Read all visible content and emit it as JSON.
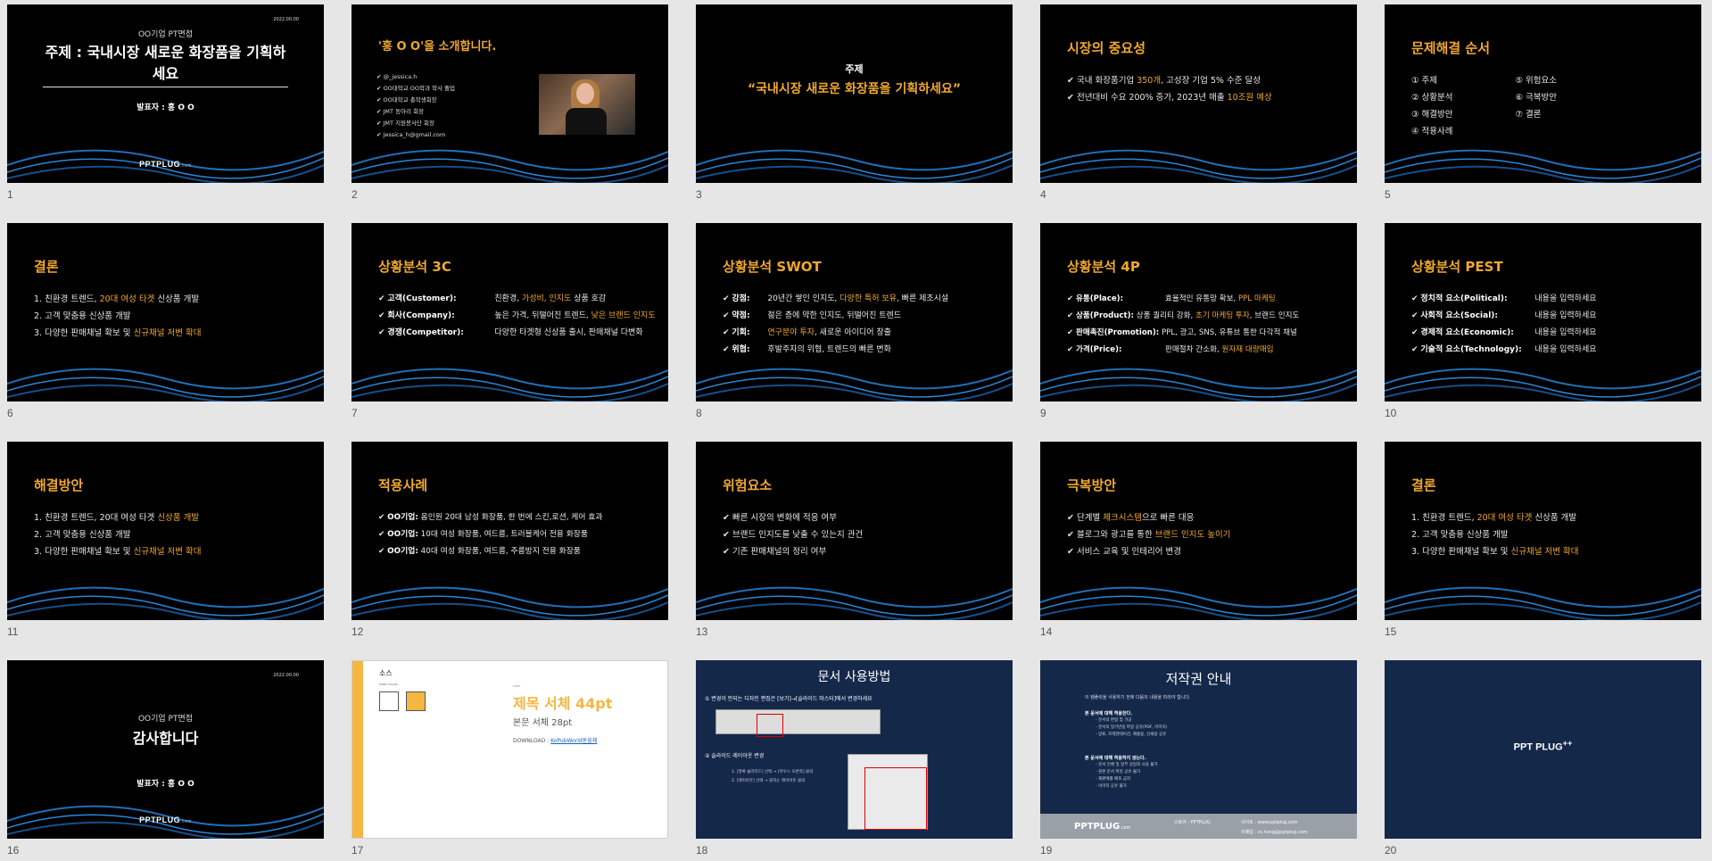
{
  "slides": [
    {
      "n": "1",
      "date": "2022.00.00",
      "sub": "OO기업 PT면접",
      "title": "주제 : 국내시장 새로운 화장품을 기획하세요",
      "presenter": "발표자 : 홍 O O",
      "logo": "PPTPLUG",
      "logo_suffix": ".com"
    },
    {
      "n": "2",
      "title": "'홍 O O'을 소개합니다.",
      "items": [
        "@_jessica.h",
        "OO대학교 OO학과 학사 졸업",
        "OO대학교 총학생회장",
        "JMT 동아리 회장",
        "JMT 지원봉사단 회장",
        "jessica_h@gmail.com"
      ]
    },
    {
      "n": "3",
      "title": "주제",
      "subtitle": "“국내시장 새로운 화장품을 기획하세요”"
    },
    {
      "n": "4",
      "title": "시장의 중요성",
      "l1a": "국내 화장품기업 ",
      "l1b": "350개",
      "l1c": ", 고성장 기업 5% 수준 달성",
      "l2a": "전년대비 수요 200% 증가, 2023년 매출 ",
      "l2b": "10조원 예상"
    },
    {
      "n": "5",
      "title": "문제해결 순서",
      "col1": [
        "① 주제",
        "② 상황분석",
        "③ 해결방안",
        "④ 적용사례"
      ],
      "col2": [
        "⑤ 위험요소",
        "⑥ 극복방안",
        "⑦ 결론"
      ]
    },
    {
      "n": "6",
      "title": "결론",
      "l1a": "1.  친환경 트렌드, ",
      "l1b": "20대 여성 타겟",
      "l1c": " 신상품 개발",
      "l2": "2.  고객 맞춤용 신상품 개발",
      "l3a": "3.  다양한 판매채널 확보 및 ",
      "l3b": "신규채널 저변 확대"
    },
    {
      "n": "7",
      "title": "상황분석 3C",
      "r1k": "고객(Customer):",
      "r1a": "친환경, ",
      "r1b": "가성비, 인지도",
      "r1c": " 상품 호감",
      "r2k": "회사(Company):",
      "r2a": "높은 가격, 뒤떨어진 트렌드, ",
      "r2b": "낮은 브랜드 인지도",
      "r3k": "경쟁(Competitor):",
      "r3a": "다양한 타겟형 신상품 출시, 판매채널 다변화"
    },
    {
      "n": "8",
      "title": "상황분석 SWOT",
      "r1k": "강점:",
      "r1a": "20년간 쌓인 인지도, ",
      "r1b": "다양한 특허 보유",
      "r1c": ", 빠른 제조시설",
      "r2k": "약점:",
      "r2a": "젊은 층에 약한 인지도, 뒤떨어진 트렌드",
      "r3k": "기회:",
      "r3a": "연구분야 투자",
      "r3b": ", 새로운 아이디어 창출",
      "r4k": "위협:",
      "r4a": "후발주자의 위협, 트렌드의 빠른 변화"
    },
    {
      "n": "9",
      "title": "상황분석 4P",
      "r1k": "유통(Place):",
      "r1a": "효율적인 유통망 확보, ",
      "r1b": "PPL 마케팅",
      "r2k": "상품(Product):",
      "r2a": "상품 퀄리티 강화, ",
      "r2b": "초기 마케팅 투자",
      "r2c": ", 브랜드 인지도",
      "r3k": "판매촉진(Promotion):",
      "r3a": "PPL, 광고, SNS, 유튜브 통한 다각적 채널",
      "r4k": "가격(Price):",
      "r4a": "판매절차 간소화, ",
      "r4b": "원자재 대량매입"
    },
    {
      "n": "10",
      "title": "상황분석 PEST",
      "r1k": "정치적 요소(Political):",
      "r2k": "사회적 요소(Social):",
      "r3k": "경제적 요소(Economic):",
      "r4k": "기술적 요소(Technology):",
      "val": "내용을 입력하세요"
    },
    {
      "n": "11",
      "title": "해결방안",
      "l1a": "1.  친환경 트렌드, 20대 여성 타겟 ",
      "l1b": "신상품 개발",
      "l2": "2.  고객 맞춤용 신상품 개발",
      "l3a": "3.  다양한 판매채널 확보 및 ",
      "l3b": "신규채널 저변 확대"
    },
    {
      "n": "12",
      "title": "적용사례",
      "r1k": "OO기업:",
      "r1a": "옴인원 20대 남성 화장품, 한 번에 스킨,로션, 케어 효과",
      "r2k": "OO기업:",
      "r2a": "10대 여성 화장품, 여드름, 트러블케어 전용 화장품",
      "r3k": "OO기업:",
      "r3a": "40대 여성 화장품, 여드름, 주름방지 전용 화장품"
    },
    {
      "n": "13",
      "title": "위험요소",
      "items": [
        "빠른 시장의 변화에 적응 여부",
        "브랜드 인지도를 낮출 수 있는지 관건",
        "기존 판매채널의 정리 여부"
      ]
    },
    {
      "n": "14",
      "title": "극복방안",
      "l1a": "단계별 ",
      "l1b": "체크시스템",
      "l1c": "으로 빠른 대응",
      "l2a": "블로그와 광고를 통한 ",
      "l2b": "브랜드 인지도 높이기",
      "l3": "서비스 교육 및 인테리어 변경"
    },
    {
      "n": "15",
      "title": "결론",
      "l1a": "1.  친환경 트렌드, ",
      "l1b": "20대 여성 타겟",
      "l1c": " 신상품 개발",
      "l2": "2.  고객 맞춤용 신상품 개발",
      "l3a": "3.  다양한 판매채널 확보 및 ",
      "l3b": "신규채널 저변 확대"
    },
    {
      "n": "16",
      "date": "2022.00.00",
      "sub": "OO기업 PT면접",
      "title": "감사합니다",
      "presenter": "발표자 : 홍 O O",
      "logo": "PPTPLUG",
      "logo_suffix": ".com"
    },
    {
      "n": "17",
      "label": "소스",
      "label2": "POINT COLOR",
      "fonttag": "FONT",
      "t1": "제목 서체 44pt",
      "t2": "본문 서체 28pt",
      "t3": "DOWNLOAD :",
      "t3link": "KoPubWorld돋움체"
    },
    {
      "n": "18",
      "title": "문서 사용방법",
      "step1": "①  변경이 안되는 디자인 편집은 [보기]→[슬라이드 마스터]에서 변경하세요",
      "step2": "②  슬라이드 레이아웃 변경",
      "sub1": "1. [영록 슬라이드] 선택 → [마우스 오른쪽] 클릭",
      "sub2": "2. [레이아웃] 선택 → 원하는 레이아웃 클릭"
    },
    {
      "n": "19",
      "title": "저작권 안내",
      "p": "이 템플릿을 사용하기 전에 다음의 내용을 따라야 합니다.",
      "h1": "본 문서에 대해 허용한다.",
      "a": [
        "문서의 변형 및 가공",
        "문서의 일기반용 파일 공유(PDF, 이미지)",
        "방표, 프레젠테이션, 제출용, 인쇄용 공유"
      ],
      "h2": "본 문서에 대해 허용하지 않는다.",
      "b": [
        "문서 전체 및 일부 상업적 사용 불가",
        "원본 문서 파일 공유 불가",
        "재판매를 배포 금지",
        "이미지 공유 불가"
      ],
      "logo": "PPTPLUG",
      "logo_suffix": ".com",
      "f1": "스토어 : PPTPLUG",
      "f2": "사이트 : www.pptplug.com",
      "f3": "이메일 : cs.hong@pptplug.com"
    },
    {
      "n": "20",
      "logo": "PPT PLUG",
      "plus": "++"
    }
  ]
}
